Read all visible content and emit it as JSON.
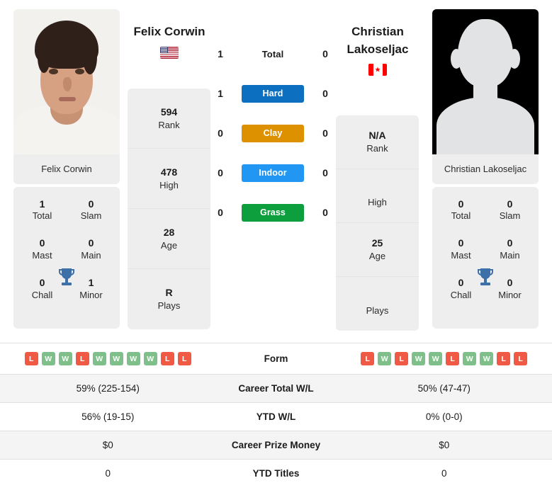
{
  "players": {
    "left": {
      "name": "Felix Corwin",
      "country_flag": "us-flag-icon",
      "photo_name": "Felix Corwin",
      "rank": "594",
      "rank_label": "Rank",
      "high": "478",
      "high_label": "High",
      "age": "28",
      "age_label": "Age",
      "plays": "R",
      "plays_label": "Plays",
      "titles": {
        "total": "1",
        "total_label": "Total",
        "slam": "0",
        "slam_label": "Slam",
        "mast": "0",
        "mast_label": "Mast",
        "main": "0",
        "main_label": "Main",
        "chall": "0",
        "chall_label": "Chall",
        "minor": "1",
        "minor_label": "Minor"
      },
      "form": [
        "L",
        "W",
        "W",
        "L",
        "W",
        "W",
        "W",
        "W",
        "L",
        "L"
      ],
      "career_total_wl": "59% (225-154)",
      "ytd_wl": "56% (19-15)",
      "career_prize_money": "$0",
      "ytd_titles": "0"
    },
    "right": {
      "name": "Christian Lakoseljac",
      "name_line1": "Christian",
      "name_line2": "Lakoseljac",
      "country_flag": "ca-flag-icon",
      "photo_name": "Christian Lakoseljac",
      "rank": "N/A",
      "rank_label": "Rank",
      "high": "",
      "high_label": "High",
      "age": "25",
      "age_label": "Age",
      "plays": "",
      "plays_label": "Plays",
      "titles": {
        "total": "0",
        "total_label": "Total",
        "slam": "0",
        "slam_label": "Slam",
        "mast": "0",
        "mast_label": "Mast",
        "main": "0",
        "main_label": "Main",
        "chall": "0",
        "chall_label": "Chall",
        "minor": "0",
        "minor_label": "Minor"
      },
      "form": [
        "L",
        "W",
        "L",
        "W",
        "W",
        "L",
        "W",
        "W",
        "L",
        "L"
      ],
      "career_total_wl": "50% (47-47)",
      "ytd_wl": "0% (0-0)",
      "career_prize_money": "$0",
      "ytd_titles": "0"
    }
  },
  "surfaces": [
    {
      "key": "total",
      "label": "Total",
      "left": "1",
      "right": "0",
      "color": "transparent",
      "plain": true
    },
    {
      "key": "hard",
      "label": "Hard",
      "left": "1",
      "right": "0",
      "color": "#0d6fbf",
      "plain": false
    },
    {
      "key": "clay",
      "label": "Clay",
      "left": "0",
      "right": "0",
      "color": "#dd9000",
      "plain": false
    },
    {
      "key": "indoor",
      "label": "Indoor",
      "left": "0",
      "right": "0",
      "color": "#2196f3",
      "plain": false
    },
    {
      "key": "grass",
      "label": "Grass",
      "left": "0",
      "right": "0",
      "color": "#0d9e3e",
      "plain": false
    }
  ],
  "table": {
    "rows": [
      {
        "label": "Form",
        "type": "form",
        "left": "",
        "right": "",
        "shaded": false
      },
      {
        "label": "Career Total W/L",
        "type": "text",
        "left": "59% (225-154)",
        "right": "50% (47-47)",
        "shaded": true
      },
      {
        "label": "YTD W/L",
        "type": "text",
        "left": "56% (19-15)",
        "right": "0% (0-0)",
        "shaded": false
      },
      {
        "label": "Career Prize Money",
        "type": "text",
        "left": "$0",
        "right": "$0",
        "shaded": true
      },
      {
        "label": "YTD Titles",
        "type": "text",
        "left": "0",
        "right": "0",
        "shaded": false
      }
    ]
  },
  "colors": {
    "hard": "#0d6fbf",
    "clay": "#dd9000",
    "indoor": "#2196f3",
    "grass": "#0d9e3e",
    "win": "#7fc08a",
    "loss": "#f05a45",
    "trophy": "#3d6fa8",
    "card_bg": "#eeeeee"
  }
}
